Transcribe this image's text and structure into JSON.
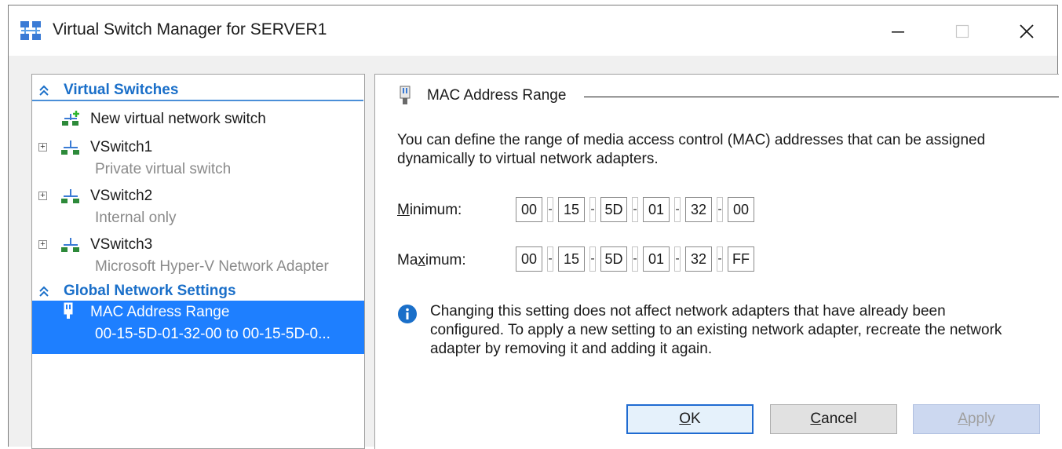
{
  "window": {
    "title": "Virtual Switch Manager for SERVER1",
    "controls": {
      "minimize": "minimize",
      "maximize": "maximize",
      "close": "close"
    }
  },
  "tree": {
    "groups": [
      {
        "label": "Virtual Switches"
      },
      {
        "label": "Global Network Settings"
      }
    ],
    "new_switch": "New virtual network switch",
    "switches": [
      {
        "name": "VSwitch1",
        "type": "Private virtual switch"
      },
      {
        "name": "VSwitch2",
        "type": "Internal only"
      },
      {
        "name": "VSwitch3",
        "type": "Microsoft Hyper-V Network Adapter"
      }
    ],
    "mac_item": {
      "label": "MAC Address Range",
      "value": "00-15-5D-01-32-00 to 00-15-5D-0..."
    }
  },
  "content": {
    "section_title": "MAC Address Range",
    "description": "You can define the range of media access control (MAC) addresses that can be assigned dynamically to virtual network adapters.",
    "minimum": {
      "label_pre": "",
      "label_u": "M",
      "label_post": "inimum:",
      "octets": [
        "00",
        "15",
        "5D",
        "01",
        "32",
        "00"
      ]
    },
    "maximum": {
      "label_pre": "Ma",
      "label_u": "x",
      "label_post": "imum:",
      "octets": [
        "00",
        "15",
        "5D",
        "01",
        "32",
        "FF"
      ]
    },
    "separator": "-",
    "info": "Changing this setting does not affect network adapters that have already been configured.  To apply a new setting to an existing network adapter, recreate the network adapter by removing it and adding it again."
  },
  "buttons": {
    "ok": {
      "u": "O",
      "rest": "K"
    },
    "cancel": {
      "u": "C",
      "rest": "ancel"
    },
    "apply": {
      "u": "A",
      "rest": "pply"
    }
  },
  "colors": {
    "accent": "#1e7fff",
    "group_header": "#1a6fc9",
    "info_icon": "#1a6fc9",
    "disabled_text": "#a0a0a0"
  }
}
